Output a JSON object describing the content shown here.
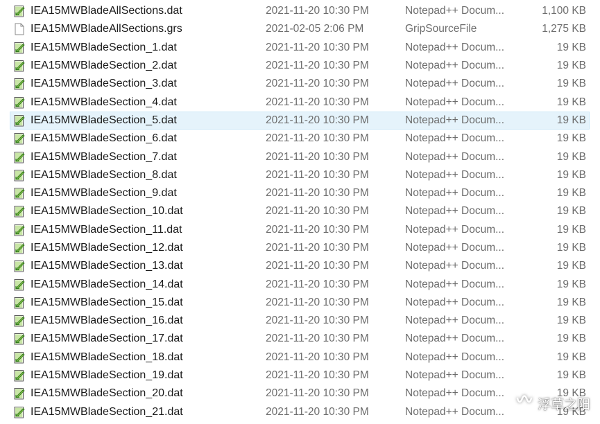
{
  "files": [
    {
      "name": "IEA15MWBladeAllSections.dat",
      "date": "2021-11-20 10:30 PM",
      "type": "Notepad++ Docum...",
      "size": "1,100 KB",
      "icon": "notepadpp-document-icon",
      "selected": false
    },
    {
      "name": "IEA15MWBladeAllSections.grs",
      "date": "2021-02-05 2:06 PM",
      "type": "GripSourceFile",
      "size": "1,275 KB",
      "icon": "generic-file-icon",
      "selected": false
    },
    {
      "name": "IEA15MWBladeSection_1.dat",
      "date": "2021-11-20 10:30 PM",
      "type": "Notepad++ Docum...",
      "size": "19 KB",
      "icon": "notepadpp-document-icon",
      "selected": false
    },
    {
      "name": "IEA15MWBladeSection_2.dat",
      "date": "2021-11-20 10:30 PM",
      "type": "Notepad++ Docum...",
      "size": "19 KB",
      "icon": "notepadpp-document-icon",
      "selected": false
    },
    {
      "name": "IEA15MWBladeSection_3.dat",
      "date": "2021-11-20 10:30 PM",
      "type": "Notepad++ Docum...",
      "size": "19 KB",
      "icon": "notepadpp-document-icon",
      "selected": false
    },
    {
      "name": "IEA15MWBladeSection_4.dat",
      "date": "2021-11-20 10:30 PM",
      "type": "Notepad++ Docum...",
      "size": "19 KB",
      "icon": "notepadpp-document-icon",
      "selected": false
    },
    {
      "name": "IEA15MWBladeSection_5.dat",
      "date": "2021-11-20 10:30 PM",
      "type": "Notepad++ Docum...",
      "size": "19 KB",
      "icon": "notepadpp-document-icon",
      "selected": true
    },
    {
      "name": "IEA15MWBladeSection_6.dat",
      "date": "2021-11-20 10:30 PM",
      "type": "Notepad++ Docum...",
      "size": "19 KB",
      "icon": "notepadpp-document-icon",
      "selected": false
    },
    {
      "name": "IEA15MWBladeSection_7.dat",
      "date": "2021-11-20 10:30 PM",
      "type": "Notepad++ Docum...",
      "size": "19 KB",
      "icon": "notepadpp-document-icon",
      "selected": false
    },
    {
      "name": "IEA15MWBladeSection_8.dat",
      "date": "2021-11-20 10:30 PM",
      "type": "Notepad++ Docum...",
      "size": "19 KB",
      "icon": "notepadpp-document-icon",
      "selected": false
    },
    {
      "name": "IEA15MWBladeSection_9.dat",
      "date": "2021-11-20 10:30 PM",
      "type": "Notepad++ Docum...",
      "size": "19 KB",
      "icon": "notepadpp-document-icon",
      "selected": false
    },
    {
      "name": "IEA15MWBladeSection_10.dat",
      "date": "2021-11-20 10:30 PM",
      "type": "Notepad++ Docum...",
      "size": "19 KB",
      "icon": "notepadpp-document-icon",
      "selected": false
    },
    {
      "name": "IEA15MWBladeSection_11.dat",
      "date": "2021-11-20 10:30 PM",
      "type": "Notepad++ Docum...",
      "size": "19 KB",
      "icon": "notepadpp-document-icon",
      "selected": false
    },
    {
      "name": "IEA15MWBladeSection_12.dat",
      "date": "2021-11-20 10:30 PM",
      "type": "Notepad++ Docum...",
      "size": "19 KB",
      "icon": "notepadpp-document-icon",
      "selected": false
    },
    {
      "name": "IEA15MWBladeSection_13.dat",
      "date": "2021-11-20 10:30 PM",
      "type": "Notepad++ Docum...",
      "size": "19 KB",
      "icon": "notepadpp-document-icon",
      "selected": false
    },
    {
      "name": "IEA15MWBladeSection_14.dat",
      "date": "2021-11-20 10:30 PM",
      "type": "Notepad++ Docum...",
      "size": "19 KB",
      "icon": "notepadpp-document-icon",
      "selected": false
    },
    {
      "name": "IEA15MWBladeSection_15.dat",
      "date": "2021-11-20 10:30 PM",
      "type": "Notepad++ Docum...",
      "size": "19 KB",
      "icon": "notepadpp-document-icon",
      "selected": false
    },
    {
      "name": "IEA15MWBladeSection_16.dat",
      "date": "2021-11-20 10:30 PM",
      "type": "Notepad++ Docum...",
      "size": "19 KB",
      "icon": "notepadpp-document-icon",
      "selected": false
    },
    {
      "name": "IEA15MWBladeSection_17.dat",
      "date": "2021-11-20 10:30 PM",
      "type": "Notepad++ Docum...",
      "size": "19 KB",
      "icon": "notepadpp-document-icon",
      "selected": false
    },
    {
      "name": "IEA15MWBladeSection_18.dat",
      "date": "2021-11-20 10:30 PM",
      "type": "Notepad++ Docum...",
      "size": "19 KB",
      "icon": "notepadpp-document-icon",
      "selected": false
    },
    {
      "name": "IEA15MWBladeSection_19.dat",
      "date": "2021-11-20 10:30 PM",
      "type": "Notepad++ Docum...",
      "size": "19 KB",
      "icon": "notepadpp-document-icon",
      "selected": false
    },
    {
      "name": "IEA15MWBladeSection_20.dat",
      "date": "2021-11-20 10:30 PM",
      "type": "Notepad++ Docum...",
      "size": "19 KB",
      "icon": "notepadpp-document-icon",
      "selected": false
    },
    {
      "name": "IEA15MWBladeSection_21.dat",
      "date": "2021-11-20 10:30 PM",
      "type": "Notepad++ Docum...",
      "size": "19 KB",
      "icon": "notepadpp-document-icon",
      "selected": false
    }
  ],
  "watermark": {
    "text": "浮草之阳",
    "icon": "wechat-channel-icon"
  },
  "colors": {
    "selection_bg": "#e5f3fb",
    "selection_border": "#cde8f7",
    "name_text": "#1a1a1a",
    "detail_text": "#6d6d6d"
  }
}
